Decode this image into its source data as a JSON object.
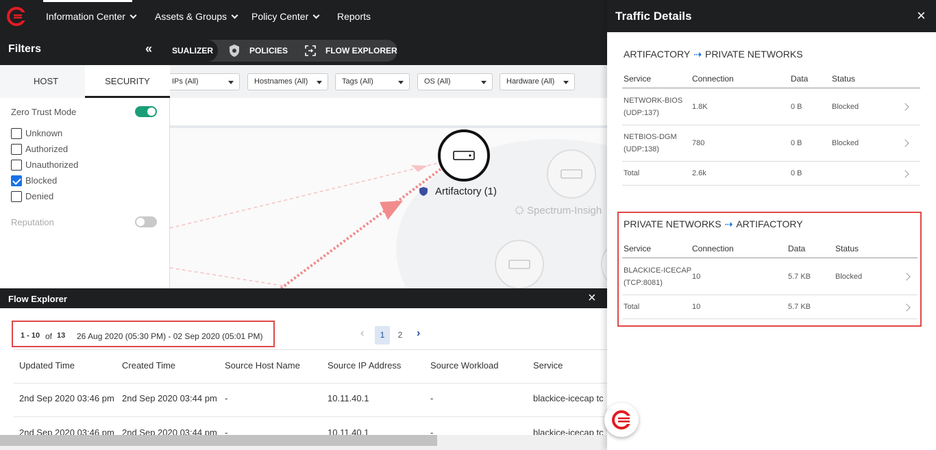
{
  "nav": {
    "items": [
      {
        "label": "Information Center",
        "has_dropdown": true
      },
      {
        "label": "Assets & Groups",
        "has_dropdown": true
      },
      {
        "label": "Policy Center",
        "has_dropdown": true
      },
      {
        "label": "Reports",
        "has_dropdown": false
      }
    ]
  },
  "subnav": {
    "items": [
      {
        "label": "SUALIZER",
        "icon": "visualizer-icon",
        "active": true
      },
      {
        "label": "POLICIES",
        "icon": "badge-icon"
      },
      {
        "label": "FLOW EXPLORER",
        "icon": "flow-icon"
      }
    ]
  },
  "filters": {
    "title": "Filters",
    "collapse_icon": "«",
    "tabs": [
      "HOST",
      "SECURITY"
    ],
    "active_tab": "SECURITY",
    "zero_trust_label": "Zero Trust Mode",
    "zero_trust_on": true,
    "checkboxes": [
      {
        "label": "Unknown",
        "checked": false
      },
      {
        "label": "Authorized",
        "checked": false
      },
      {
        "label": "Unauthorized",
        "checked": false
      },
      {
        "label": "Blocked",
        "checked": true
      },
      {
        "label": "Denied",
        "checked": false
      }
    ],
    "reputation_label": "Reputation",
    "reputation_on": false
  },
  "dropdowns": [
    "IPs (All)",
    "Hostnames (All)",
    "Tags (All)",
    "OS (All)",
    "Hardware (All)"
  ],
  "map": {
    "node_label": "Artifactory (1)",
    "secondary_label": "Spectrum-Insigh"
  },
  "flow_explorer": {
    "title": "Flow Explorer",
    "range_start": "1 - 10",
    "range_of": "of",
    "total": "13",
    "date_range": "26 Aug 2020 (05:30 PM) - 02 Sep 2020 (05:01 PM)",
    "pages": [
      "1",
      "2"
    ],
    "active_page": "1",
    "columns": [
      "Updated Time",
      "Created Time",
      "Source Host Name",
      "Source IP Address",
      "Source Workload",
      "Service"
    ],
    "rows": [
      [
        "2nd Sep 2020 03:46 pm",
        "2nd Sep 2020 03:44 pm",
        "-",
        "10.11.40.1",
        "-",
        "blackice-icecap tc"
      ],
      [
        "2nd Sep 2020 03:46 pm",
        "2nd Sep 2020 03:44 pm",
        "-",
        "10.11.40.1",
        "-",
        "blackice-icecap tc"
      ]
    ]
  },
  "traffic_details": {
    "title": "Traffic Details",
    "sections": [
      {
        "from": "ARTIFACTORY",
        "to": "PRIVATE NETWORKS",
        "columns": [
          "Service",
          "Connection",
          "Data",
          "Status"
        ],
        "rows": [
          {
            "service": "NETWORK-BIOS",
            "port": "(UDP:137)",
            "connection": "1.8K",
            "data": "0 B",
            "status": "Blocked"
          },
          {
            "service": "NETBIOS-DGM",
            "port": "(UDP:138)",
            "connection": "780",
            "data": "0 B",
            "status": "Blocked"
          }
        ],
        "total": {
          "label": "Total",
          "connection": "2.6k",
          "data": "0 B"
        }
      },
      {
        "from": "PRIVATE NETWORKS",
        "to": "ARTIFACTORY",
        "columns": [
          "Service",
          "Connection",
          "Data",
          "Status"
        ],
        "rows": [
          {
            "service": "BLACKICE-ICECAP",
            "port": "(TCP:8081)",
            "connection": "10",
            "data": "5.7 KB",
            "status": "Blocked"
          }
        ],
        "total": {
          "label": "Total",
          "connection": "10",
          "data": "5.7 KB"
        }
      }
    ]
  },
  "colors": {
    "dark": "#1e1f21",
    "accent_green": "#1a9e78",
    "accent_blue": "#1a73e8",
    "highlight_red": "#e04848",
    "flow_red": "#f28c8c"
  }
}
